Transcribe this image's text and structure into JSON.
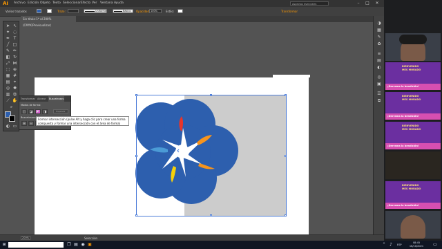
{
  "app": {
    "logo": "Ai",
    "menu": [
      "Archivo",
      "Edición",
      "Objeto",
      "Texto",
      "Seleccionar",
      "Efecto",
      "Ver",
      "Ventana",
      "Ayuda"
    ],
    "search_placeholder": "Aspectos esenciales"
  },
  "control_bar": {
    "selection_label": "Varios trazados",
    "stroke_label": "Trazo:",
    "stroke_style": "Uniforme",
    "brush_style": "Básico",
    "opacity_label": "Opacidad:",
    "opacity_value": "100%",
    "style_label": "Estilo:",
    "transform_label": "Transformar"
  },
  "document": {
    "tab_title": "Sin título-1* al 200% (CMYK/Previsualizar)"
  },
  "pathfinder_panel": {
    "tabs": [
      "Transformar",
      "Alinear",
      "Buscatrazos"
    ],
    "active_tab": "Buscatrazos",
    "modes_label": "Modos de forma:",
    "pathfinders_label": "Buscatrazos:",
    "expand_label": "Expandir",
    "tooltip": "Formar intersección (pulse Alt y haga clic para crear una forma compuesta y formar una intersección con el área de forma)"
  },
  "status_bar": {
    "zoom": "200%",
    "tool": "Selección"
  },
  "taskbar": {
    "time": "08:45",
    "date": "16/10/2021",
    "language": "ESP"
  },
  "meet_tiles": {
    "promo_title_line1": "BIENVENIDO",
    "promo_title_line2": "MES MORADO",
    "promo_band": "¡Derrama la bendición!"
  },
  "colors": {
    "ui_dark": "#333333",
    "canvas_bg": "#535353",
    "artwork_blue": "#2d5fae",
    "petal_red": "#e8352a",
    "petal_orange": "#f7941d",
    "petal_yellow": "#f5d10a",
    "petal_lightblue": "#4b9bd6",
    "promo_purple": "#6b2fa0",
    "promo_pink": "#d74fb1"
  }
}
